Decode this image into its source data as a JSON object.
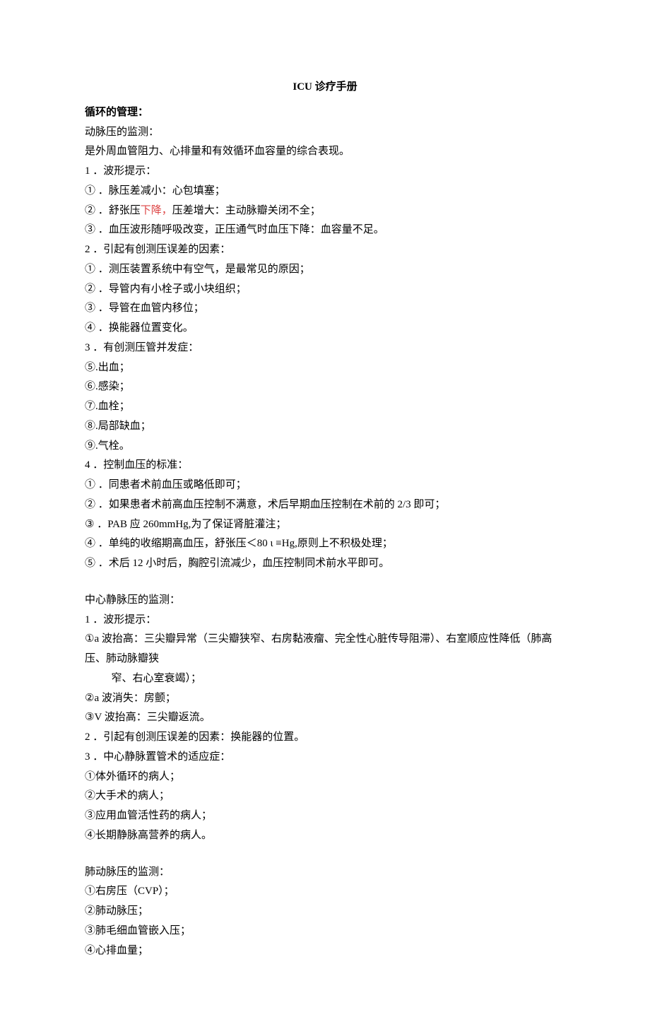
{
  "title": "ICU 诊疗手册",
  "h1": "循环的管理：",
  "s1h": "动脉压的监测：",
  "s1def": "是外周血管阻力、心排量和有效循环血容量的综合表现。",
  "p1_1": "1 ．波形提示：",
  "p1_1a": "① ．脉压差减小：心包填塞；",
  "p1_1b_pre": "② ．舒张压",
  "p1_1b_red": "下降，",
  "p1_1b_post": "压差增大：主动脉瓣关闭不全；",
  "p1_1c": "③ ．血压波形随呼吸改变，正压通气时血压下降：血容量不足。",
  "p1_2": "2 ．引起有创测压误差的因素：",
  "p1_2a": "① ．测压装置系统中有空气，是最常见的原因；",
  "p1_2b": "② ．导管内有小栓子或小块组织；",
  "p1_2c": "③ ．导管在血管内移位；",
  "p1_2d": "④ ．换能器位置变化。",
  "p1_3": "3 ．有创测压管并发症：",
  "p1_3a": "⑤.出血；",
  "p1_3b": "⑥.感染；",
  "p1_3c": "⑦.血栓；",
  "p1_3d": "⑧.局部缺血；",
  "p1_3e": "⑨.气栓。",
  "p1_4": "4 ．控制血压的标准：",
  "p1_4a": "① ．同患者术前血压或略低即可；",
  "p1_4b": "② ．如果患者术前高血压控制不满意，术后早期血压控制在术前的 2/3 即可；",
  "p1_4c": "③ ．PAB 应 260mmHg,为了保证肾脏灌注；",
  "p1_4d": "④ ．单纯的收缩期高血压，舒张压＜80 ι ≡Hg,原则上不积极处理；",
  "p1_4e": "⑤ ．术后 12 小时后，胸腔引流减少，血压控制同术前水平即可。",
  "s2h": "中心静脉压的监测：",
  "p2_1": "1 ．波形提示：",
  "p2_1a_l1": "①a 波抬高：三尖瓣异常（三尖瓣狭窄、右房黏液瘤、完全性心脏传导阻滞）、右室顺应性降低（肺高压、肺动脉瓣狭",
  "p2_1a_l2": "窄、右心室衰竭）；",
  "p2_1b": "②a 波消失：房颤；",
  "p2_1c": "③V 波抬高：三尖瓣返流。",
  "p2_2": "2 ．引起有创测压误差的因素：换能器的位置。",
  "p2_3": "3 ．中心静脉置管术的适应症：",
  "p2_3a": "①体外循环的病人；",
  "p2_3b": "②大手术的病人；",
  "p2_3c": "③应用血管活性药的病人；",
  "p2_3d": "④长期静脉高营养的病人。",
  "s3h": "肺动脉压的监测：",
  "p3a": "①右房压（CVP）；",
  "p3b": "②肺动脉压；",
  "p3c": "③肺毛细血管嵌入压；",
  "p3d": "④心排血量；"
}
